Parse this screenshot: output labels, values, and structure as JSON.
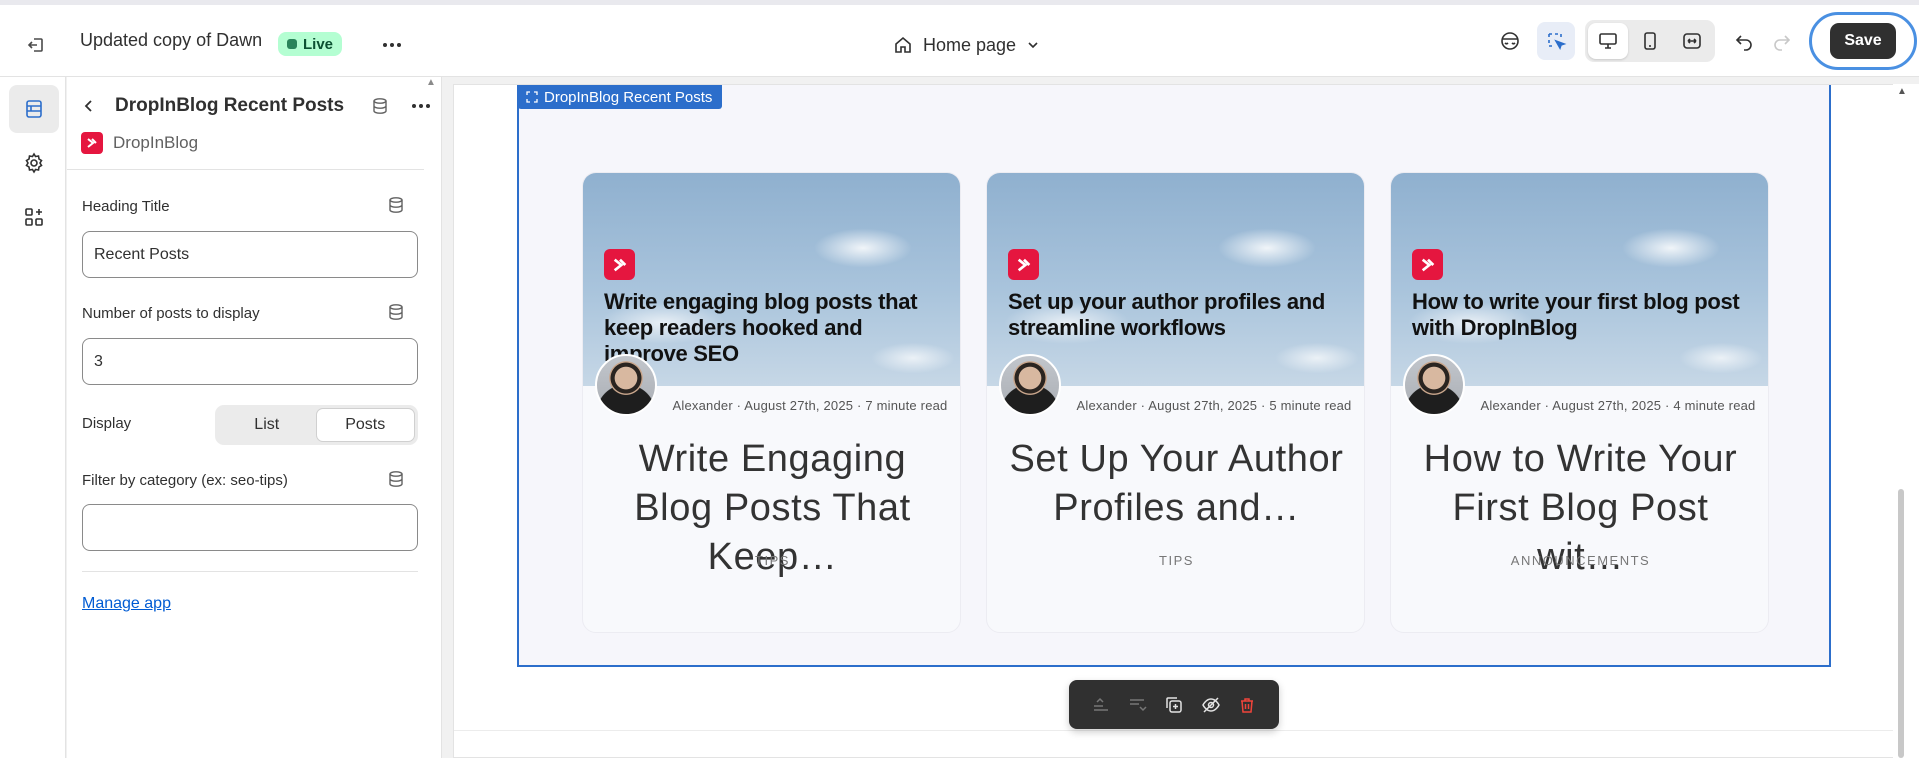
{
  "topbar": {
    "theme_name": "Updated copy of Dawn",
    "status_badge": "Live",
    "page_selector": "Home page",
    "save_label": "Save",
    "icons": [
      "exit-icon",
      "more-horizontal-icon",
      "home-icon",
      "chevron-down-icon",
      "preview-eye-icon",
      "inspector-icon",
      "desktop-icon",
      "mobile-icon",
      "fullwidth-icon",
      "undo-icon",
      "redo-icon"
    ]
  },
  "rail": {
    "items": [
      "sections-icon",
      "settings-gear-icon",
      "apps-icon"
    ]
  },
  "panel": {
    "title": "DropInBlog Recent Posts",
    "app_name": "DropInBlog",
    "heading_title_label": "Heading Title",
    "heading_title_value": "Recent Posts",
    "num_posts_label": "Number of posts to display",
    "num_posts_value": "3",
    "display_label": "Display",
    "display_options": [
      "List",
      "Posts"
    ],
    "display_selected": "Posts",
    "filter_label": "Filter by category (ex: seo-tips)",
    "filter_value": "",
    "manage_link": "Manage app"
  },
  "preview": {
    "section_tag": "DropInBlog Recent Posts",
    "cards": [
      {
        "image_title": "Write engaging blog posts that keep readers hooked and improve SEO",
        "author": "Alexander",
        "date": "August 27th, 2025",
        "read_time": "7 minute read",
        "title": "Write Engaging Blog Posts That Keep…",
        "category": "TIPS"
      },
      {
        "image_title": "Set up your author profiles and streamline workflows",
        "author": "Alexander",
        "date": "August 27th, 2025",
        "read_time": "5 minute read",
        "title": "Set Up Your Author Profiles and…",
        "category": "TIPS"
      },
      {
        "image_title": "How to write your first blog post with DropInBlog",
        "author": "Alexander",
        "date": "August 27th, 2025",
        "read_time": "4 minute read",
        "title": "How to Write Your First Blog Post wit…",
        "category": "ANNOUNCEMENTS"
      }
    ]
  },
  "floating_toolbar": {
    "icons": [
      "move-up-icon",
      "move-down-icon",
      "duplicate-icon",
      "hide-eye-icon",
      "delete-trash-icon"
    ]
  },
  "colors": {
    "accent_blue": "#2c6ecb",
    "live_green": "#b4fed2",
    "brand_red": "#e5163f",
    "save_dark": "#303030"
  }
}
